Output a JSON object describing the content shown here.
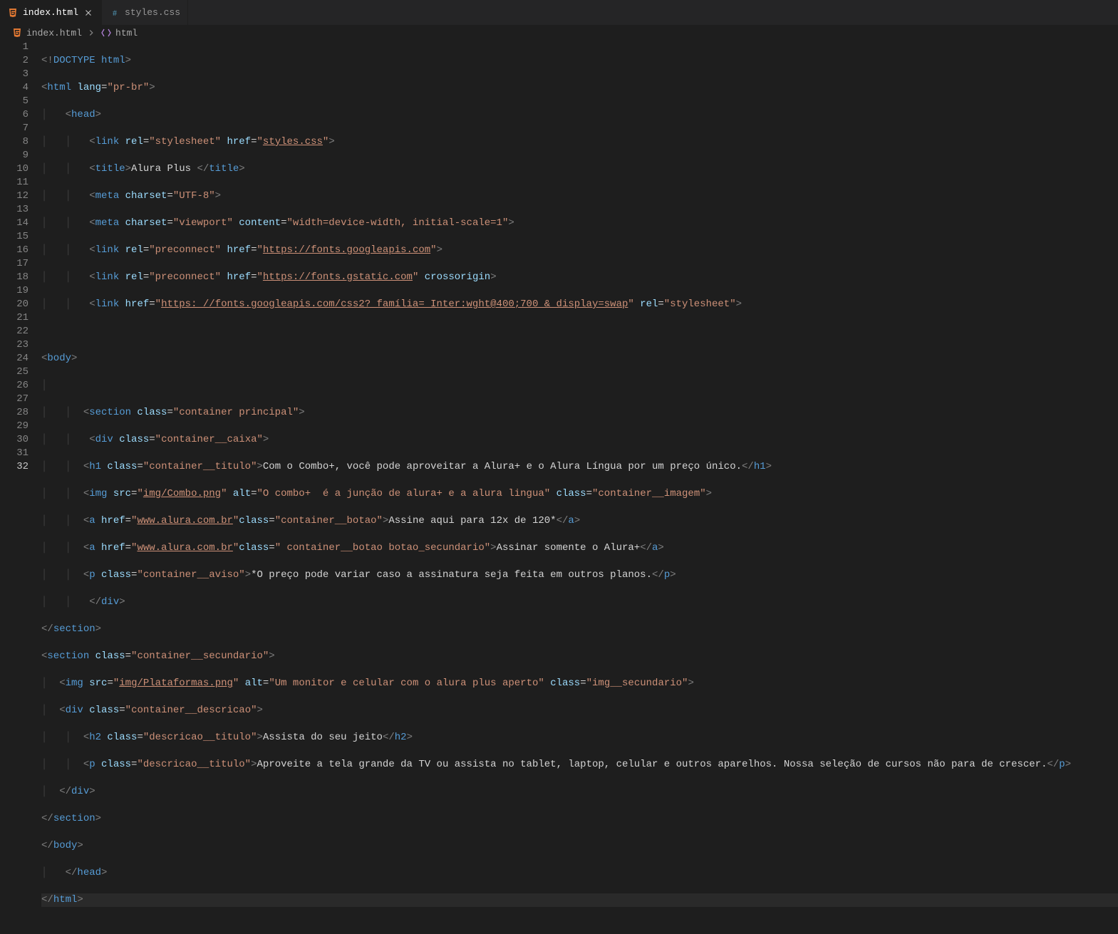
{
  "tabs": [
    {
      "label": "index.html",
      "active": true,
      "icon": "html-icon"
    },
    {
      "label": "styles.css",
      "active": false,
      "icon": "css-icon"
    }
  ],
  "breadcrumbs": [
    {
      "label": "index.html",
      "icon": "html-icon"
    },
    {
      "label": "html",
      "icon": "brackets-icon"
    }
  ],
  "lineNumbers": [
    "1",
    "2",
    "3",
    "4",
    "5",
    "6",
    "7",
    "8",
    "9",
    "10",
    "11",
    "12",
    "13",
    "14",
    "15",
    "16",
    "17",
    "18",
    "19",
    "20",
    "21",
    "22",
    "23",
    "24",
    "25",
    "26",
    "27",
    "28",
    "29",
    "30",
    "31",
    "32"
  ],
  "currentLine": 32,
  "code": {
    "l1": {
      "a": "<!",
      "b": "DOCTYPE",
      "c": " html",
      "d": ">"
    },
    "l2": {
      "a": "<",
      "b": "html",
      "c": " lang",
      "d": "=",
      "e": "\"pr-br\"",
      "f": ">"
    },
    "l3": {
      "a": "<",
      "b": "head",
      "c": ">"
    },
    "l4": {
      "a": "<",
      "b": "link",
      "c": " rel",
      "d": "=",
      "e": "\"stylesheet\"",
      "f": " href",
      "g": "=",
      "h": "\"",
      "i": "styles.css",
      "j": "\"",
      "k": ">"
    },
    "l5": {
      "a": "<",
      "b": "title",
      "c": ">",
      "d": "Alura Plus ",
      "e": "</",
      "f": "title",
      "g": ">"
    },
    "l6": {
      "a": "<",
      "b": "meta",
      "c": " charset",
      "d": "=",
      "e": "\"UTF-8\"",
      "f": ">"
    },
    "l7": {
      "a": "<",
      "b": "meta",
      "c": " charset",
      "d": "=",
      "e": "\"viewport\"",
      "f": " content",
      "g": "=",
      "h": "\"width=device-width, initial-scale=1\"",
      "i": ">"
    },
    "l8": {
      "a": "<",
      "b": "link",
      "c": " rel",
      "d": "=",
      "e": "\"preconnect\"",
      "f": " href",
      "g": "=",
      "h": "\"",
      "i": "https://fonts.googleapis.com",
      "j": "\"",
      "k": ">"
    },
    "l9": {
      "a": "<",
      "b": "link",
      "c": " rel",
      "d": "=",
      "e": "\"preconnect\"",
      "f": " href",
      "g": "=",
      "h": "\"",
      "i": "https://fonts.gstatic.com",
      "j": "\"",
      "k": " crossorigin",
      "l": ">"
    },
    "l10": {
      "a": "<",
      "b": "link",
      "c": " href",
      "d": "=",
      "e": "\"",
      "f": "https: //fonts.googleapis.com/css2? família= Inter:wght@400;700 & display=swap",
      "g": "\"",
      "h": " rel",
      "i": "=",
      "j": "\"stylesheet\"",
      "k": ">"
    },
    "l12": {
      "a": "<",
      "b": "body",
      "c": ">"
    },
    "l14": {
      "a": "<",
      "b": "section",
      "c": " class",
      "d": "=",
      "e": "\"container principal\"",
      "f": ">"
    },
    "l15": {
      "a": "<",
      "b": "div",
      "c": " class",
      "d": "=",
      "e": "\"container__caixa\"",
      "f": ">"
    },
    "l16": {
      "a": "<",
      "b": "h1",
      "c": " class",
      "d": "=",
      "e": "\"container__titulo\"",
      "f": ">",
      "g": "Com o Combo+, você pode aproveitar a Alura+ e o Alura Língua por um preço único.",
      "h": "</",
      "i": "h1",
      "j": ">"
    },
    "l17": {
      "a": "<",
      "b": "img",
      "c": " src",
      "d": "=",
      "e": "\"",
      "f": "img/Combo.png",
      "g": "\"",
      "h": " alt",
      "i": "=",
      "j": "\"O combo+  é a junção de alura+ e a alura lingua\"",
      "k": " class",
      "l": "=",
      "m": "\"container__imagem\"",
      "n": ">"
    },
    "l18": {
      "a": "<",
      "b": "a",
      "c": " href",
      "d": "=",
      "e": "\"",
      "f": "www.alura.com.br",
      "g": "\"",
      "h": "class",
      "i": "=",
      "j": "\"container__botao\"",
      "k": ">",
      "l": "Assine aqui para 12x de 120*",
      "m": "</",
      "n": "a",
      "o": ">"
    },
    "l19": {
      "a": "<",
      "b": "a",
      "c": " href",
      "d": "=",
      "e": "\"",
      "f": "www.alura.com.br",
      "g": "\"",
      "h": "class",
      "i": "=",
      "j": "\" container__botao botao_secundario\"",
      "k": ">",
      "l": "Assinar somente o Alura+",
      "m": "</",
      "n": "a",
      "o": ">"
    },
    "l20": {
      "a": "<",
      "b": "p",
      "c": " class",
      "d": "=",
      "e": "\"container__aviso\"",
      "f": ">",
      "g": "*O preço pode variar caso a assinatura seja feita em outros planos.",
      "h": "</",
      "i": "p",
      "j": ">"
    },
    "l21": {
      "a": "</",
      "b": "div",
      "c": ">"
    },
    "l22": {
      "a": "</",
      "b": "section",
      "c": ">"
    },
    "l23": {
      "a": "<",
      "b": "section",
      "c": " class",
      "d": "=",
      "e": "\"container__secundario\"",
      "f": ">"
    },
    "l24": {
      "a": "<",
      "b": "img",
      "c": " src",
      "d": "=",
      "e": "\"",
      "f": "img/Plataformas.png",
      "g": "\"",
      "h": " alt",
      "i": "=",
      "j": "\"Um monitor e celular com o alura plus aperto\"",
      "k": " class",
      "l": "=",
      "m": "\"img__secundario\"",
      "n": ">"
    },
    "l25": {
      "a": "<",
      "b": "div",
      "c": " class",
      "d": "=",
      "e": "\"container__descricao\"",
      "f": ">"
    },
    "l26": {
      "a": "<",
      "b": "h2",
      "c": " class",
      "d": "=",
      "e": "\"descricao__titulo\"",
      "f": ">",
      "g": "Assista do seu jeito",
      "h": "</",
      "i": "h2",
      "j": ">"
    },
    "l27": {
      "a": "<",
      "b": "p",
      "c": " class",
      "d": "=",
      "e": "\"descricao__titulo\"",
      "f": ">",
      "g": "Aproveite a tela grande da TV ou assista no tablet, laptop, celular e outros aparelhos. Nossa seleção de cursos não para de crescer.",
      "h": "</",
      "i": "p",
      "j": ">"
    },
    "l28": {
      "a": "</",
      "b": "div",
      "c": ">"
    },
    "l29": {
      "a": "</",
      "b": "section",
      "c": ">"
    },
    "l30": {
      "a": "</",
      "b": "body",
      "c": ">"
    },
    "l31": {
      "a": "</",
      "b": "head",
      "c": ">"
    },
    "l32": {
      "a": "</",
      "b": "html",
      "c": ">"
    }
  }
}
